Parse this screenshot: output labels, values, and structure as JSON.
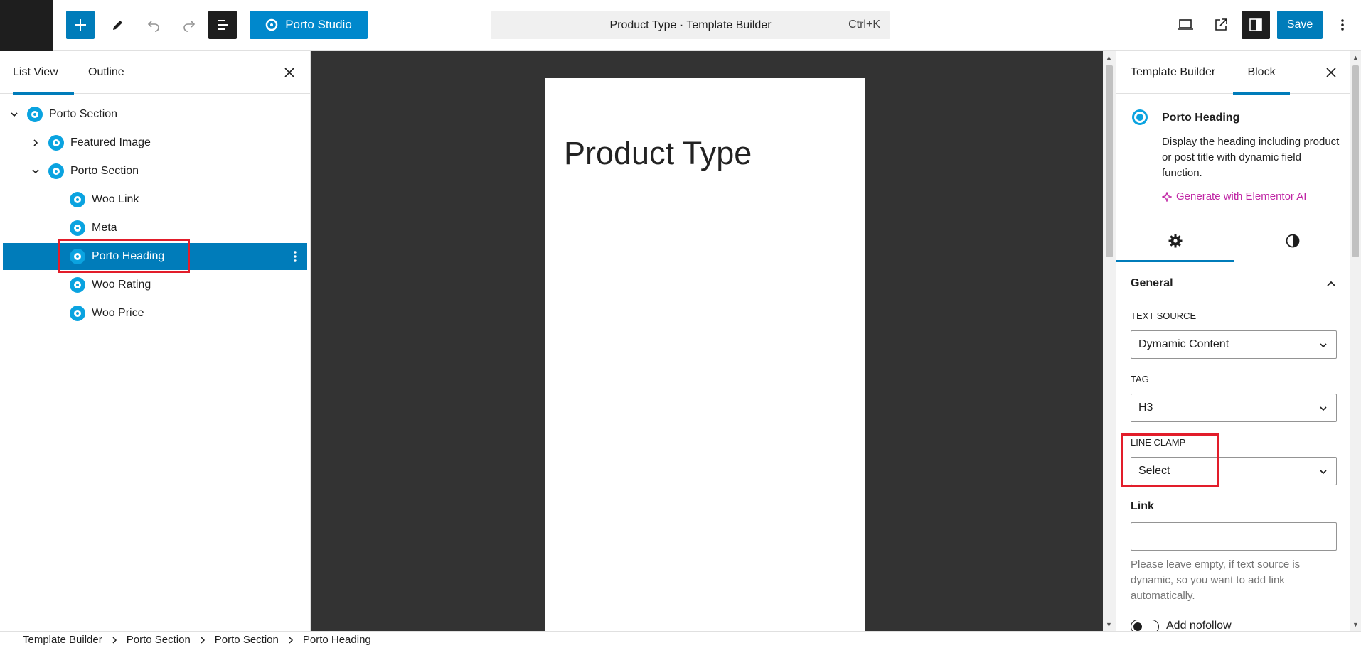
{
  "topbar": {
    "porto_studio_label": "Porto Studio",
    "command_title": "Product Type · Template Builder",
    "command_shortcut": "Ctrl+K",
    "save_label": "Save"
  },
  "left_panel": {
    "tabs": [
      {
        "label": "List View",
        "active": true
      },
      {
        "label": "Outline",
        "active": false
      }
    ],
    "tree": [
      {
        "label": "Porto Section",
        "depth": 0,
        "expandable": true,
        "expanded": true
      },
      {
        "label": "Featured Image",
        "depth": 1,
        "expandable": true,
        "expanded": false
      },
      {
        "label": "Porto Section",
        "depth": 1,
        "expandable": true,
        "expanded": true
      },
      {
        "label": "Woo Link",
        "depth": 2,
        "expandable": false
      },
      {
        "label": "Meta",
        "depth": 2,
        "expandable": false
      },
      {
        "label": "Porto Heading",
        "depth": 2,
        "expandable": false,
        "selected": true
      },
      {
        "label": "Woo Rating",
        "depth": 2,
        "expandable": false
      },
      {
        "label": "Woo Price",
        "depth": 2,
        "expandable": false
      }
    ]
  },
  "canvas": {
    "heading": "Product Type"
  },
  "right_panel": {
    "tabs": [
      {
        "label": "Template Builder",
        "active": false
      },
      {
        "label": "Block",
        "active": true
      }
    ],
    "block": {
      "title": "Porto Heading",
      "description": "Display the heading including product or post title with dynamic field function.",
      "ai_link": "Generate with Elementor AI"
    },
    "icon_tabs": [
      {
        "icon": "gear-icon",
        "active": true
      },
      {
        "icon": "contrast-icon",
        "active": false
      }
    ],
    "section_title": "General",
    "fields": {
      "text_source_label": "TEXT SOURCE",
      "text_source_value": "Dymamic Content",
      "tag_label": "TAG",
      "tag_value": "H3",
      "line_clamp_label": "LINE CLAMP",
      "line_clamp_value": "Select",
      "link_label": "Link",
      "link_value": "",
      "link_help": "Please leave empty, if text source is dynamic, so you want to add link automatically.",
      "nofollow_label": "Add nofollow"
    }
  },
  "breadcrumb": [
    "Template Builder",
    "Porto Section",
    "Porto Section",
    "Porto Heading"
  ],
  "colors": {
    "accent": "#007cba",
    "porto_blue": "#0088cc",
    "block_icon": "#0aa3e0",
    "highlight": "#e21d2a",
    "ai_link": "#c026a5",
    "canvas_bg": "#333333"
  }
}
